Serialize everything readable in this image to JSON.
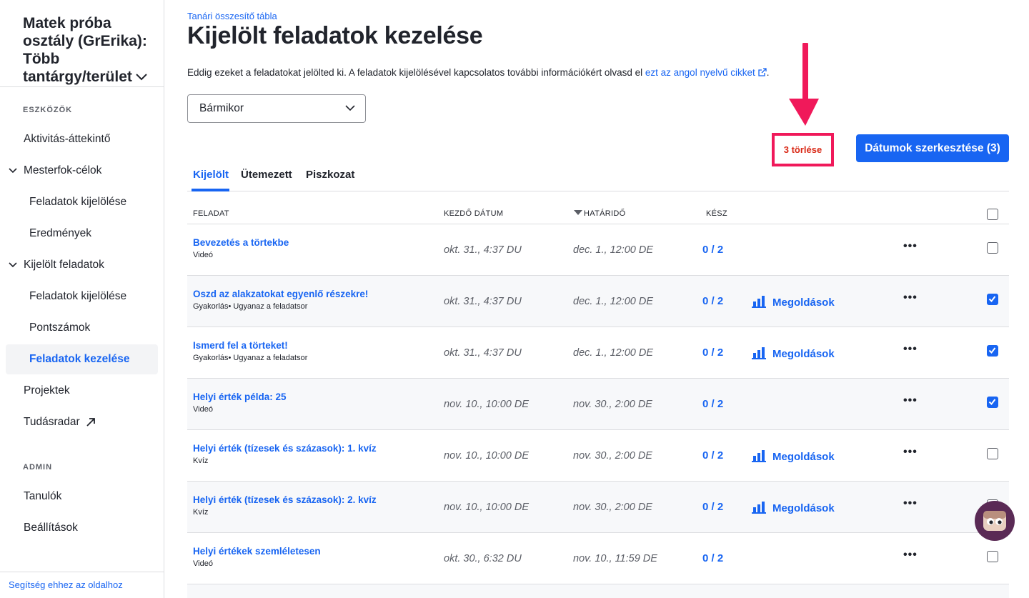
{
  "sidebar": {
    "class_title": "Matek próba osztály (GrErika): Több tantárgy/terület",
    "sections": {
      "tools": "ESZKÖZÖK",
      "admin": "ADMIN"
    },
    "items": [
      {
        "label": "Aktivitás-áttekintő"
      },
      {
        "label": "Mesterfok-célok"
      },
      {
        "label": "Feladatok kijelölése"
      },
      {
        "label": "Eredmények"
      },
      {
        "label": "Kijelölt feladatok"
      },
      {
        "label": "Feladatok kijelölése"
      },
      {
        "label": "Pontszámok"
      },
      {
        "label": "Feladatok kezelése"
      },
      {
        "label": "Projektek"
      },
      {
        "label": "Tudásradar"
      },
      {
        "label": "Tanulók"
      },
      {
        "label": "Beállítások"
      }
    ],
    "help_link": "Segítség ehhez az oldalhoz"
  },
  "header": {
    "breadcrumb": "Tanári összesítő tábla",
    "title": "Kijelölt feladatok kezelése",
    "intro_text": "Eddig ezeket a feladatokat jelölted ki. A feladatok kijelölésével kapcsolatos további információkért olvasd el",
    "intro_link": "ezt az angol nyelvű cikket",
    "intro_end": "."
  },
  "filter": {
    "selected": "Bármikor"
  },
  "actions": {
    "delete_label": "3 törlése",
    "edit_dates_label": "Dátumok szerkesztése (3)"
  },
  "tabs": [
    {
      "label": "Kijelölt"
    },
    {
      "label": "Ütemezett"
    },
    {
      "label": "Piszkozat"
    }
  ],
  "table": {
    "headers": {
      "task": "FELADAT",
      "start": "KEZDŐ DÁTUM",
      "due": "HATÁRIDŐ",
      "done": "KÉSZ"
    },
    "solutions_label": "Megoldások",
    "more_label": "•••",
    "rows": [
      {
        "name": "Bevezetés a törtekbe",
        "type": "Videó",
        "start": "okt. 31., 4:37 DU",
        "due": "dec. 1., 12:00 DE",
        "done": "0 / 2"
      },
      {
        "name": "Oszd az alakzatokat egyenlő részekre!",
        "type": "Gyakorlás• Ugyanaz a feladatsor",
        "start": "okt. 31., 4:37 DU",
        "due": "dec. 1., 12:00 DE",
        "done": "0 / 2"
      },
      {
        "name": "Ismerd fel a törteket!",
        "type": "Gyakorlás• Ugyanaz a feladatsor",
        "start": "okt. 31., 4:37 DU",
        "due": "dec. 1., 12:00 DE",
        "done": "0 / 2"
      },
      {
        "name": "Helyi érték példa: 25",
        "type": "Videó",
        "start": "nov. 10., 10:00 DE",
        "due": "nov. 30., 2:00 DE",
        "done": "0 / 2"
      },
      {
        "name": "Helyi érték (tízesek és százasok): 1. kvíz",
        "type": "Kvíz",
        "start": "nov. 10., 10:00 DE",
        "due": "nov. 30., 2:00 DE",
        "done": "0 / 2"
      },
      {
        "name": "Helyi érték (tízesek és százasok): 2. kvíz",
        "type": "Kvíz",
        "start": "nov. 10., 10:00 DE",
        "due": "nov. 30., 2:00 DE",
        "done": "0 / 2"
      },
      {
        "name": "Helyi értékek szemléletesen",
        "type": "Videó",
        "start": "okt. 30., 6:32 DU",
        "due": "nov. 10., 11:59 DE",
        "done": "0 / 2"
      }
    ]
  },
  "colors": {
    "accent": "#1865f2",
    "highlight": "#f0195a",
    "danger_text": "#d92916"
  }
}
